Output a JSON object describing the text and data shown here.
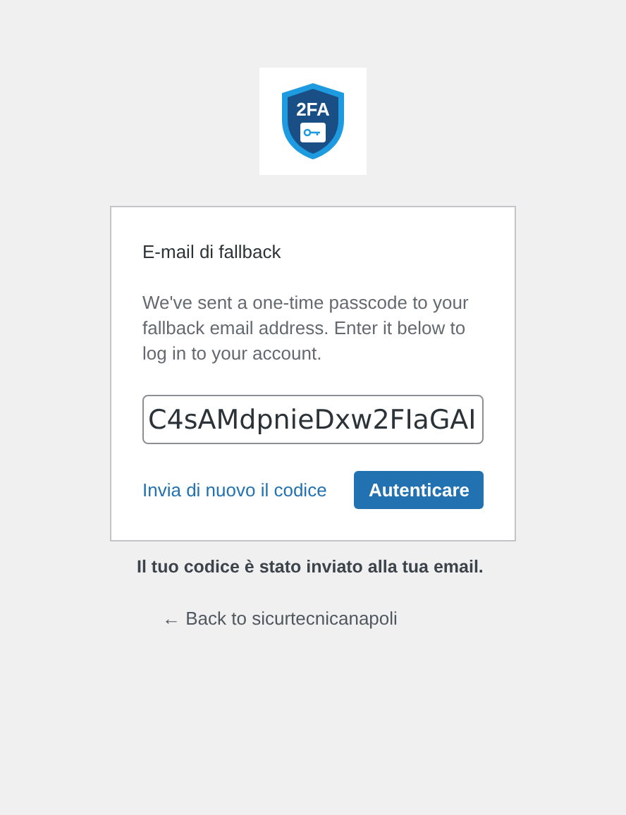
{
  "logo": {
    "text": "2FA"
  },
  "card": {
    "title": "E-mail di fallback",
    "instructions": "We've sent a one-time passcode to your fallback email address. Enter it below to log in to your account.",
    "code_field": {
      "value": "C4sAMdpnieDxw2FIaGAI"
    },
    "resend_link": "Invia di nuovo il codice",
    "submit_button": "Autenticare"
  },
  "message": "Il tuo codice è stato inviato alla tua email.",
  "back_link": "← Back to sicurtecnicanapoli"
}
